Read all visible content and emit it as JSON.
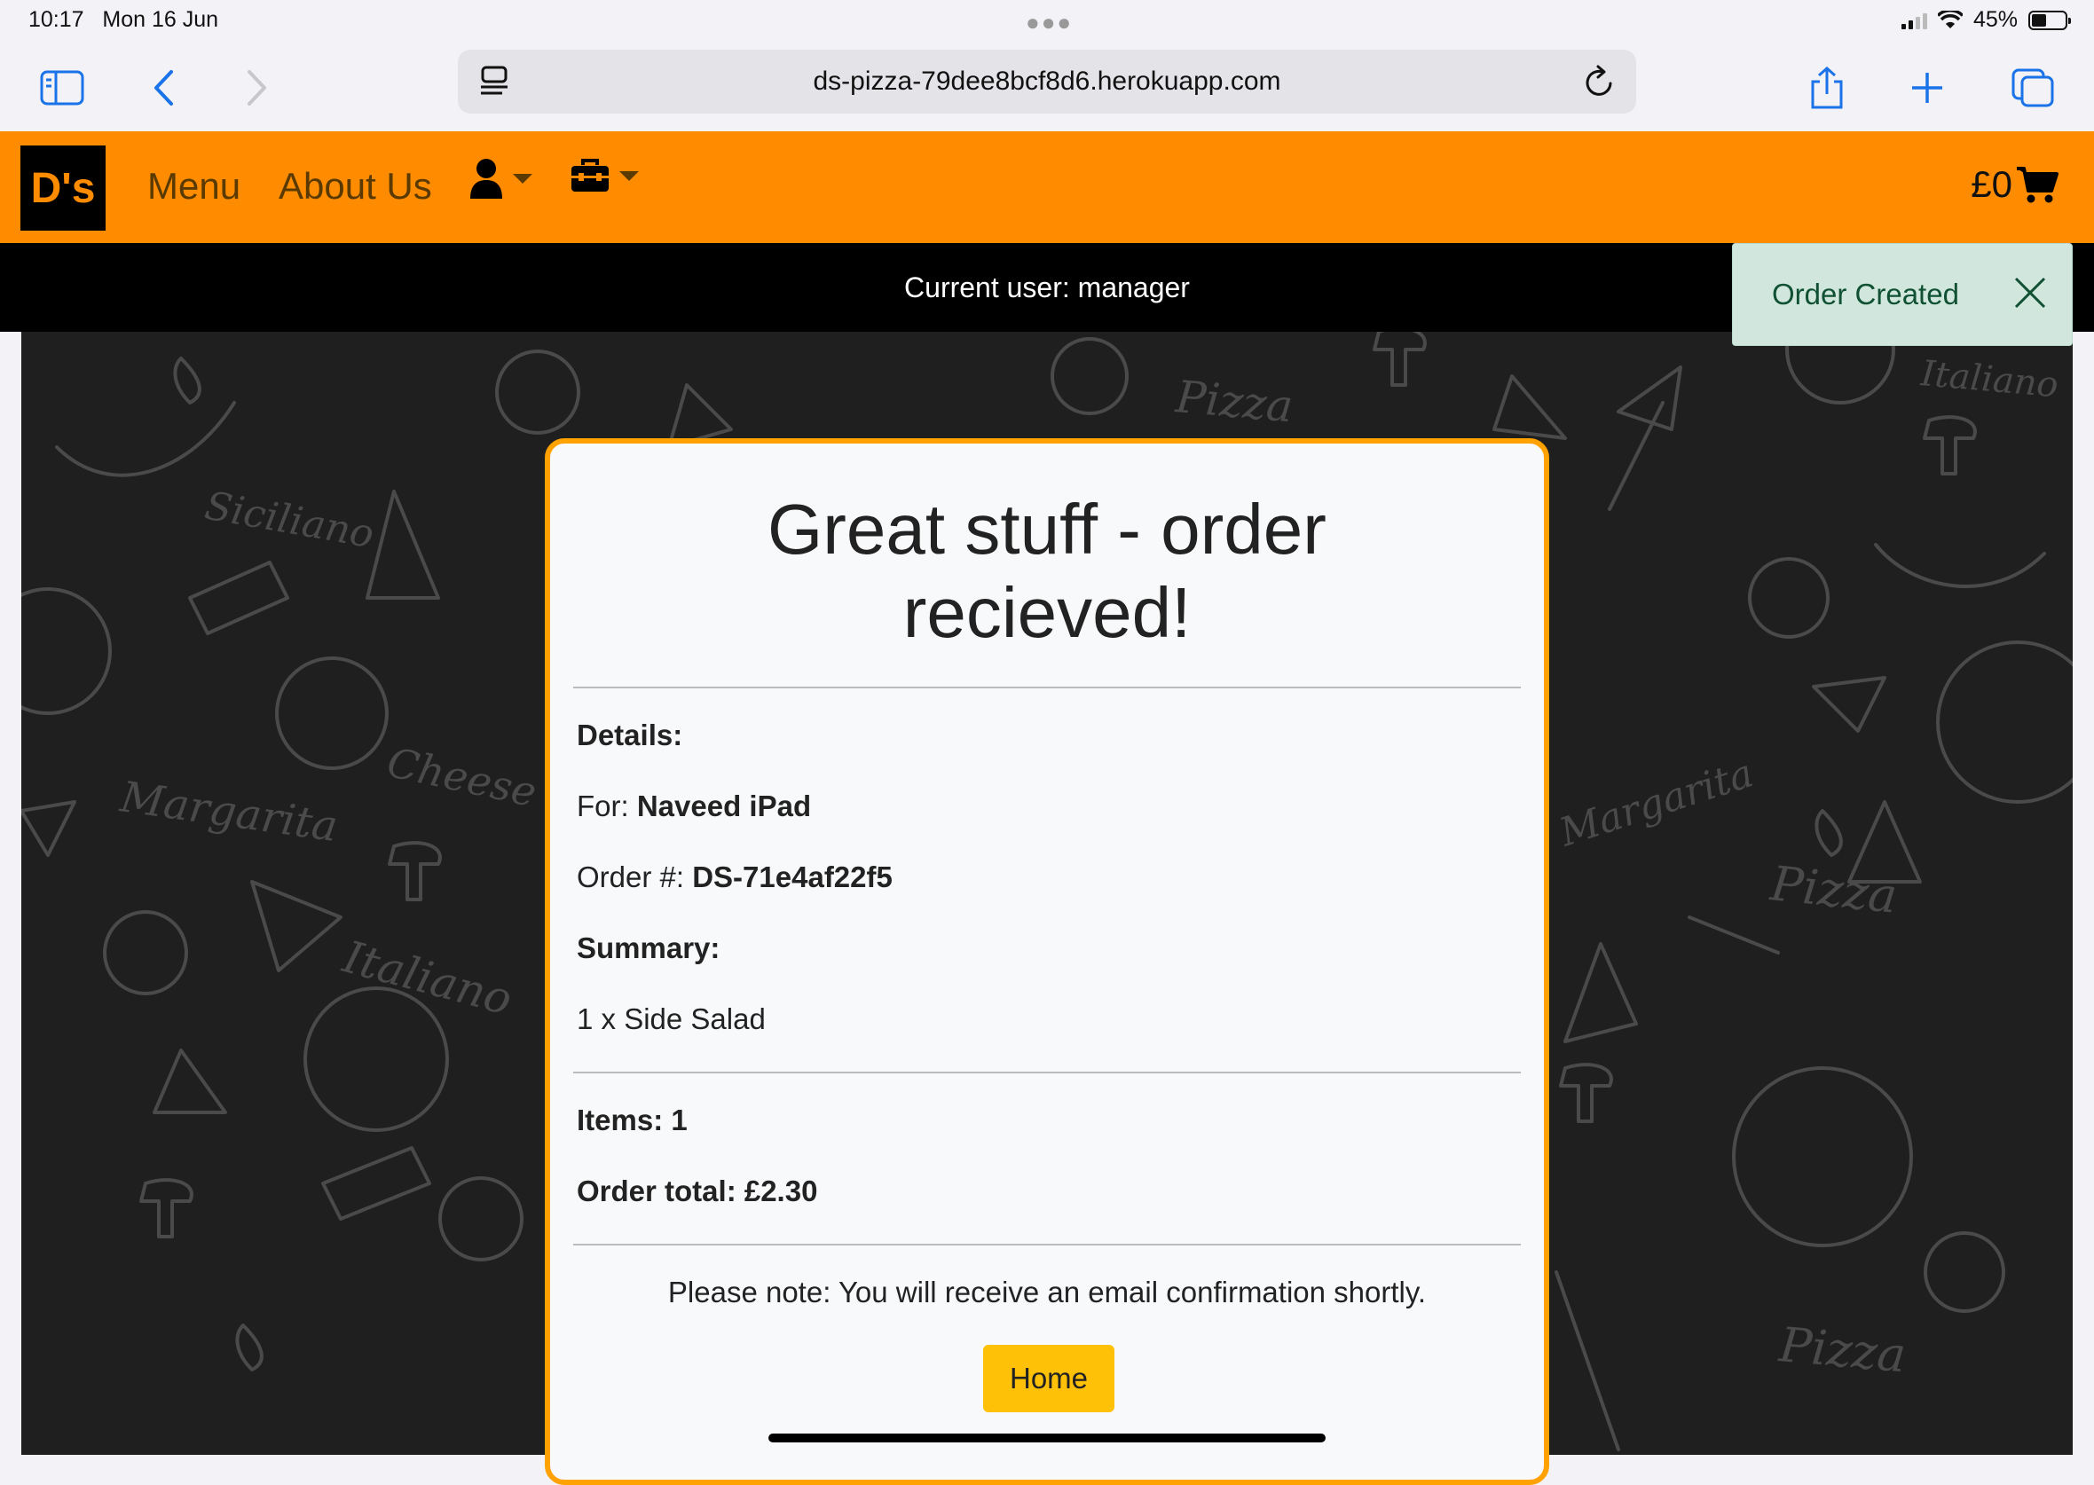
{
  "status_bar": {
    "time": "10:17",
    "date": "Mon 16 Jun",
    "battery": "45%"
  },
  "browser": {
    "url": "ds-pizza-79dee8bcf8d6.herokuapp.com"
  },
  "nav": {
    "logo": "D's",
    "links": [
      "Menu",
      "About Us"
    ],
    "cart_total": "£0"
  },
  "user_bar": {
    "text": "Current user: manager"
  },
  "toast": {
    "message": "Order Created"
  },
  "card": {
    "title": "Great stuff - order recieved!",
    "details_label": "Details:",
    "for_label": "For: ",
    "for_value": "Naveed iPad",
    "order_label": "Order #: ",
    "order_value": "DS-71e4af22f5",
    "summary_label": "Summary:",
    "summary_item": "1 x Side Salad",
    "items_label": "Items: 1",
    "total_label": "Order total: £2.30",
    "note": "Please note: You will receive an email confirmation shortly.",
    "home_button": "Home"
  },
  "background_words": [
    "Siciliano",
    "Pizza",
    "Margarita",
    "Cheese",
    "Italiano",
    "Pizza",
    "Margarita",
    "Pizza",
    "Italiano"
  ],
  "colors": {
    "brand_orange": "#ff8c00",
    "card_border": "#ffa200",
    "button_yellow": "#ffc107",
    "toast_bg": "#d1e7dd",
    "toast_text": "#0f5132"
  }
}
